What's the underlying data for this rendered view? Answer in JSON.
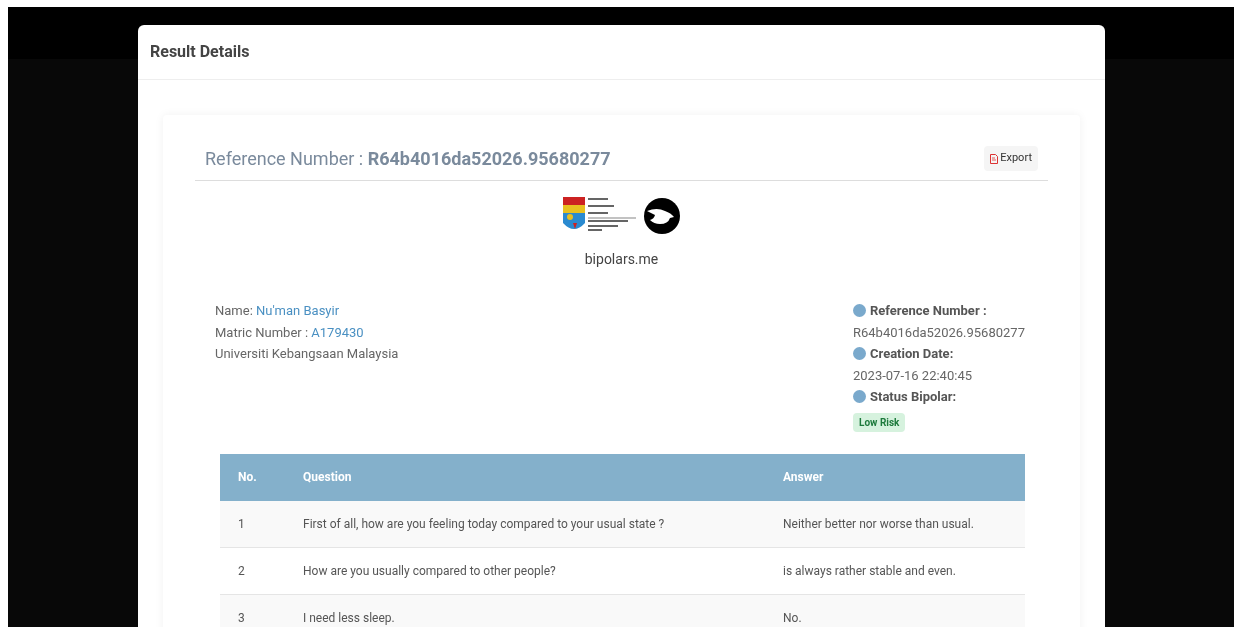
{
  "modal": {
    "title": "Result Details"
  },
  "report": {
    "reference_label": "Reference Number : ",
    "reference_value": "R64b4016da52026.95680277",
    "export_button": "Export",
    "site": "bipolars.me",
    "student": [
      {
        "label": "Name: ",
        "value": "Nu'man Basyir"
      },
      {
        "label": "Matric Number : ",
        "value": "A179430"
      },
      {
        "label": "Universiti Kebangsaan Malaysia"
      }
    ],
    "details": [
      {
        "label": "Reference Number :",
        "value": "R64b4016da52026.95680277",
        "kind": "text"
      },
      {
        "label": "Creation Date:",
        "value": "2023-07-16 22:40:45",
        "kind": "text"
      },
      {
        "label": "Status Bipolar:",
        "value": "Low Risk",
        "kind": "badge"
      }
    ],
    "table": {
      "columns": [
        "No.",
        "Question",
        "Answer"
      ],
      "rows": [
        [
          "1",
          "First of all, how are you feeling today compared to your usual state ?",
          "Neither better nor worse than usual."
        ],
        [
          "2",
          "How are you usually compared to other people?",
          "is always rather stable and even."
        ],
        [
          "3",
          "I need less sleep.",
          "No."
        ]
      ]
    }
  }
}
